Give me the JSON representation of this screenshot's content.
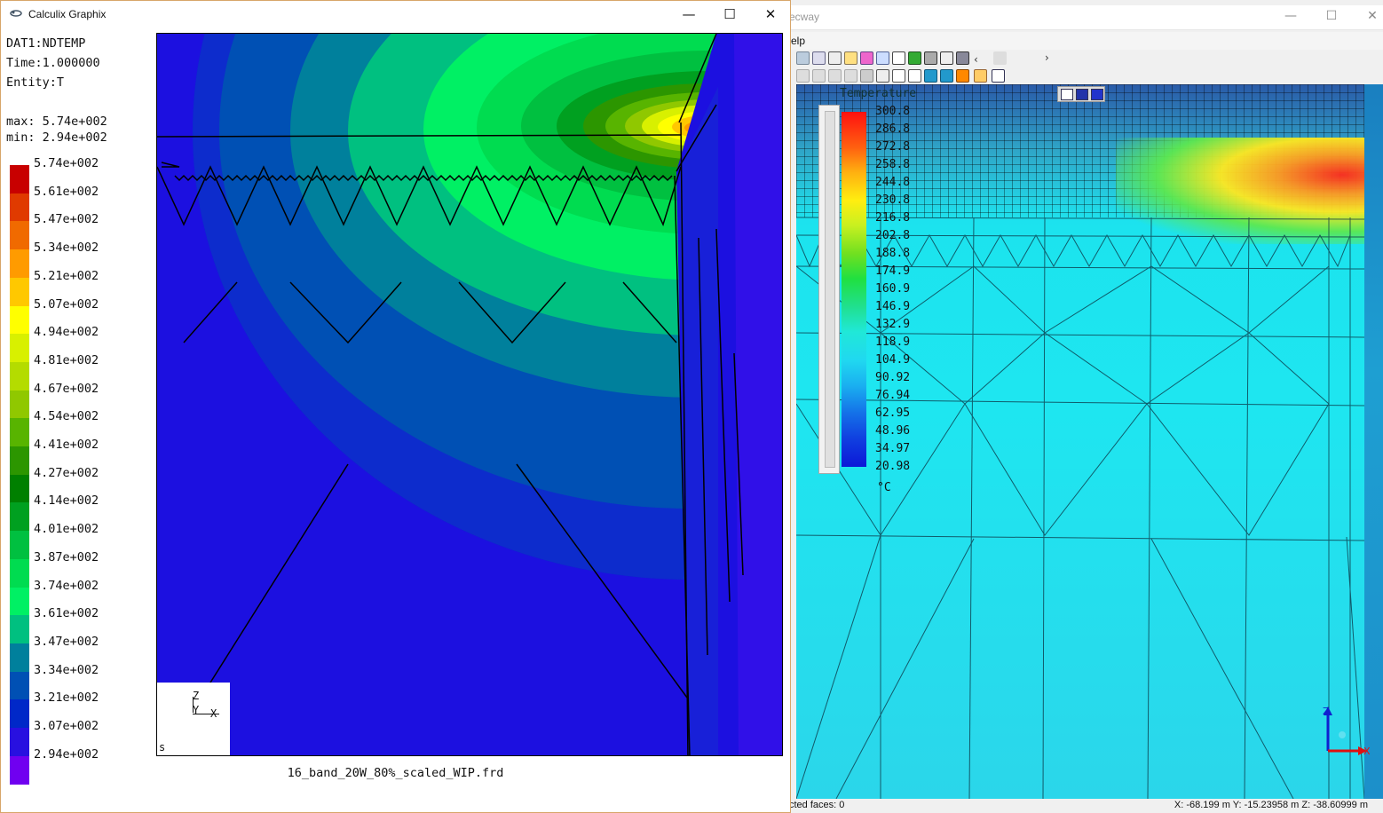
{
  "calculix_window": {
    "title": "Calculix Graphix",
    "buttons": {
      "minimize": "—",
      "maximize": "☐",
      "close": "✕"
    },
    "info_lines": [
      "DAT1:NDTEMP",
      "Time:1.000000",
      "Entity:T"
    ],
    "max_line": "max: 5.74e+002",
    "min_line": "min: 2.94e+002",
    "legend": [
      {
        "label": "5.74e+002",
        "color": "#c80000"
      },
      {
        "label": "5.61e+002",
        "color": "#e03a00"
      },
      {
        "label": "5.47e+002",
        "color": "#f06a00"
      },
      {
        "label": "5.34e+002",
        "color": "#ff9b00"
      },
      {
        "label": "5.21e+002",
        "color": "#ffc800"
      },
      {
        "label": "5.07e+002",
        "color": "#ffff00"
      },
      {
        "label": "4.94e+002",
        "color": "#d8f000"
      },
      {
        "label": "4.81e+002",
        "color": "#b4dc00"
      },
      {
        "label": "4.67e+002",
        "color": "#90c800"
      },
      {
        "label": "4.54e+002",
        "color": "#58b400"
      },
      {
        "label": "4.41e+002",
        "color": "#2c9600"
      },
      {
        "label": "4.27e+002",
        "color": "#008000"
      },
      {
        "label": "4.14e+002",
        "color": "#00a020"
      },
      {
        "label": "4.01e+002",
        "color": "#00c040"
      },
      {
        "label": "3.87e+002",
        "color": "#00dc50"
      },
      {
        "label": "3.74e+002",
        "color": "#00f064"
      },
      {
        "label": "3.61e+002",
        "color": "#00c080"
      },
      {
        "label": "3.47e+002",
        "color": "#00809c"
      },
      {
        "label": "3.34e+002",
        "color": "#0050b4"
      },
      {
        "label": "3.21e+002",
        "color": "#0028c8"
      },
      {
        "label": "3.07e+002",
        "color": "#2810e0"
      },
      {
        "label": "2.94e+002",
        "color": "#7000f0"
      }
    ],
    "triad": {
      "z": "Z",
      "y": "Y",
      "x": "X",
      "corner": "s"
    },
    "filename": "16_band_20W_80%_scaled_WIP.frd"
  },
  "mecway_window": {
    "title_fragment": "ecway",
    "buttons": {
      "minimize": "—",
      "maximize": "☐",
      "close": "✕"
    },
    "menu_fragment": "elp",
    "legend_title": "Temperature",
    "legend_values": [
      "300.8",
      "286.8",
      "272.8",
      "258.8",
      "244.8",
      "230.8",
      "216.8",
      "202.8",
      "188.8",
      "174.9",
      "160.9",
      "146.9",
      "132.9",
      "118.9",
      "104.9",
      "90.92",
      "76.94",
      "62.95",
      "48.96",
      "34.97",
      "20.98"
    ],
    "unit": "°C",
    "status_left": "cted faces: 0",
    "status_right": "X: -68.199 m Y: -15.23958 m Z: -38.60999 m",
    "toolbar_scroll_left": "‹",
    "toolbar_scroll_right": "›"
  }
}
